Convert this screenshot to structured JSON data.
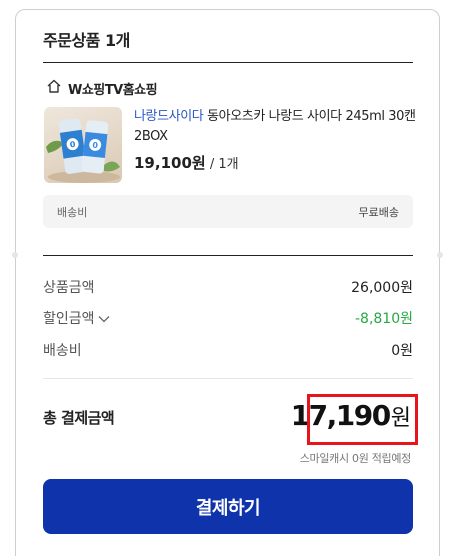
{
  "order": {
    "title": "주문상품 1개",
    "store": {
      "icon": "home-icon",
      "name": "W쇼핑TV홈쇼핑"
    },
    "product": {
      "brand": "나랑드사이다",
      "name": " 동아오츠카 나랑드 사이다 245ml 30캔 2BOX",
      "price": "19,100원",
      "quantity": " / 1개"
    },
    "shipping": {
      "label": "배송비",
      "value": "무료배송"
    }
  },
  "summary": {
    "product_amount_label": "상품금액",
    "product_amount": "26,000원",
    "discount_label": "할인금액",
    "discount_amount": "-8,810원",
    "shipping_label": "배송비",
    "shipping_amount": "0원",
    "total_label": "총 결제금액",
    "total_number": "17,190",
    "total_unit": "원",
    "points_note": "스마일캐시 0원 적립예정"
  },
  "pay_button": {
    "label": "결제하기"
  },
  "colors": {
    "accent": "#0f33ab",
    "brand_link": "#2a56c6",
    "discount": "#28a745",
    "highlight": "#e8141c"
  }
}
